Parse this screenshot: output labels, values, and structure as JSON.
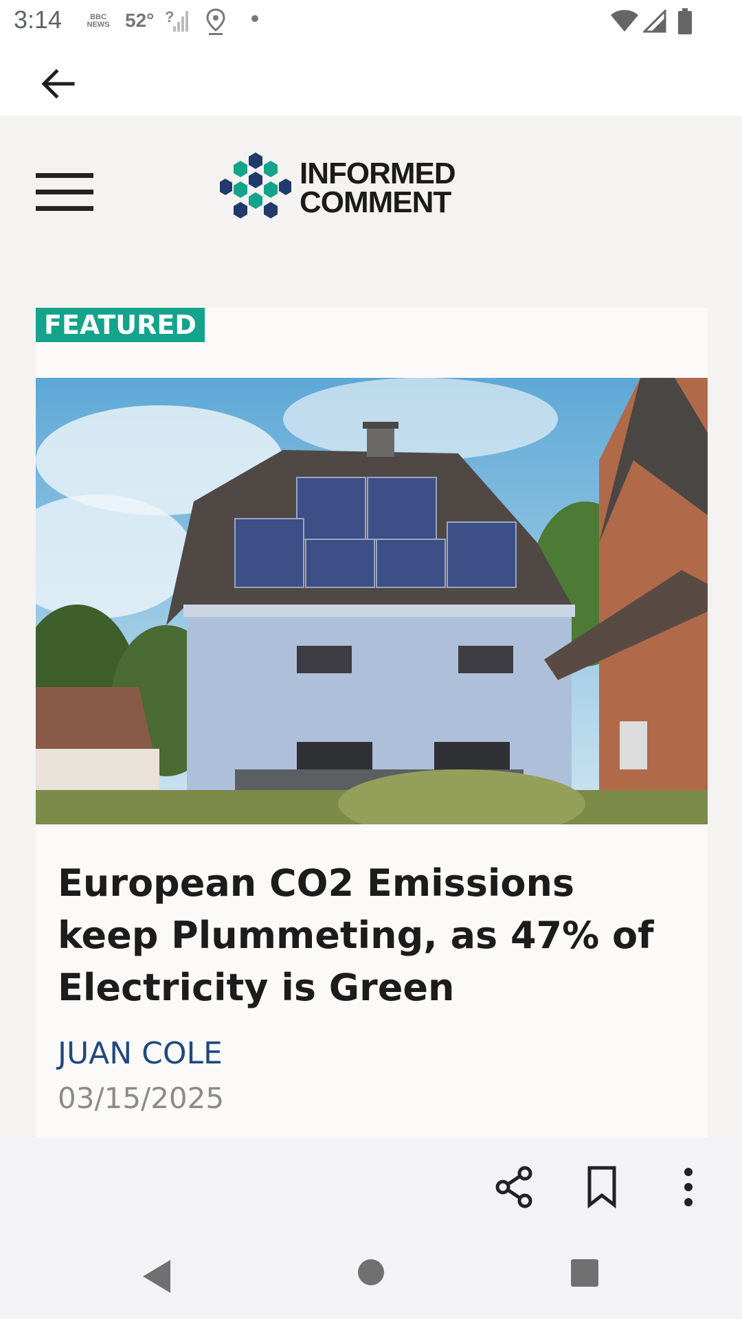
{
  "status_bar": {
    "time": "3:14",
    "news_label": "BBC NEWS",
    "temperature": "52°",
    "icons": [
      "bbc-news-icon",
      "weather-icon",
      "no-signal-icon",
      "location-icon",
      "dot-icon",
      "wifi-icon",
      "cell-signal-icon",
      "battery-icon"
    ]
  },
  "app_bar": {
    "back_icon": "arrow-back-icon"
  },
  "site": {
    "logo_line1": "INFORMED",
    "logo_line2": "COMMENT",
    "menu_icon": "hamburger-menu-icon",
    "brand_colors": {
      "teal": "#14a38b",
      "navy": "#1f3a6b"
    }
  },
  "article": {
    "badge": "FEATURED",
    "headline": "European CO2 Emissions keep Plummeting, as 47% of Electricity is Green",
    "author": "JUAN COLE",
    "date": "03/15/2025",
    "image_alt_icon": "house-with-solar-panels-photo"
  },
  "toolbar": {
    "icons": [
      "share-icon",
      "bookmark-icon",
      "more-vert-icon"
    ]
  },
  "nav_bar": {
    "icons": [
      "nav-back-icon",
      "nav-home-icon",
      "nav-recents-icon"
    ]
  }
}
